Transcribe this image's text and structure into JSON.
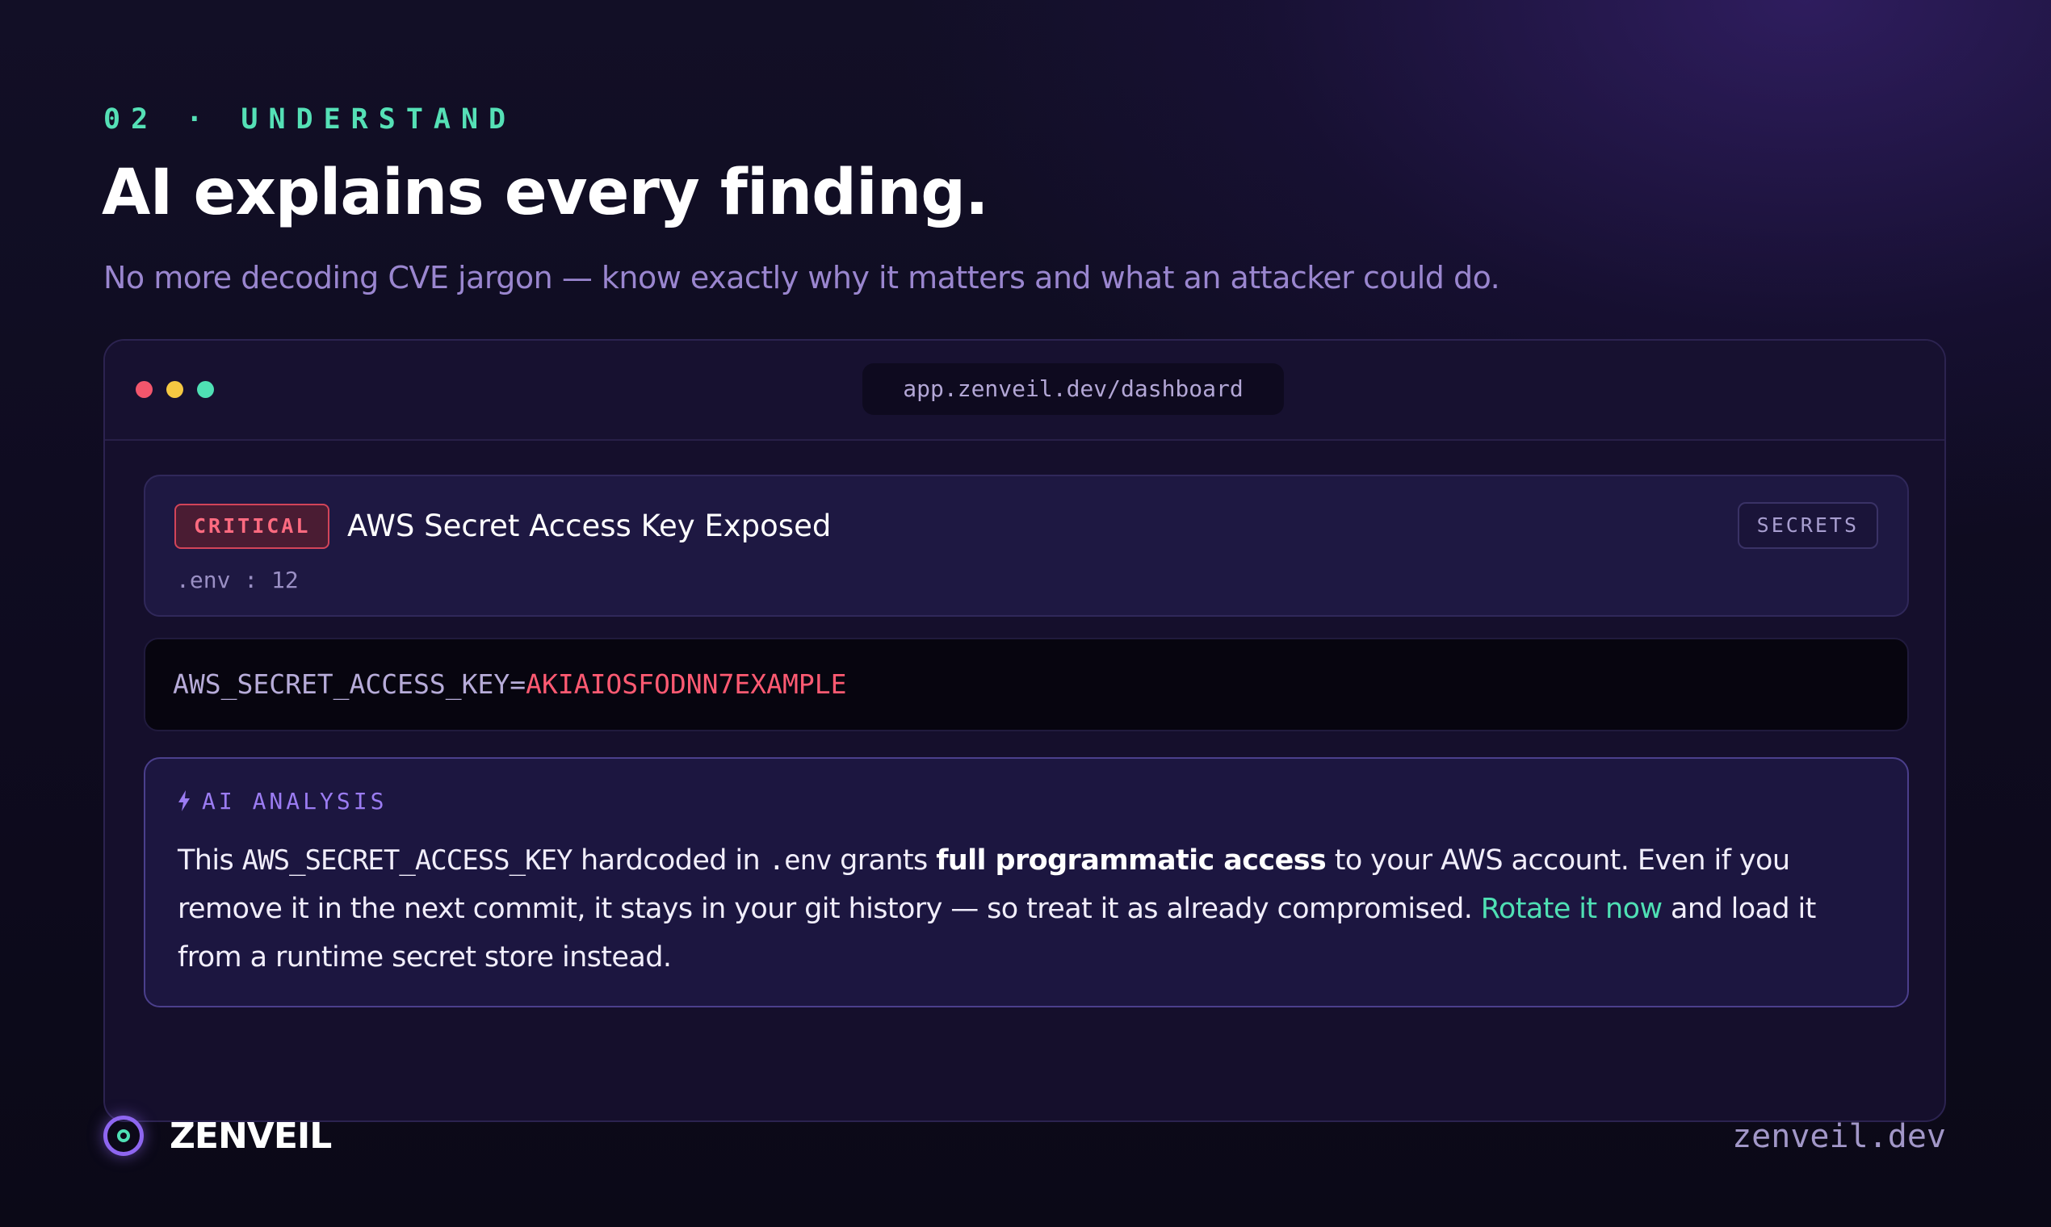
{
  "section": {
    "number": "02",
    "separator": "·",
    "name": "UNDERSTAND"
  },
  "headline": "AI explains every finding.",
  "subhead": "No more decoding CVE jargon — know exactly why it matters and what an attacker could do.",
  "window": {
    "url": "app.zenveil.dev/dashboard"
  },
  "finding": {
    "severity": "CRITICAL",
    "title": "AWS Secret Access Key Exposed",
    "location": ".env : 12",
    "category": "SECRETS",
    "code_key": "AWS_SECRET_ACCESS_KEY=",
    "code_value": "AKIAIOSFODNN7EXAMPLE"
  },
  "analysis": {
    "label": "AI ANALYSIS",
    "icon": "bolt-icon",
    "t1": "This ",
    "c1": "AWS_SECRET_ACCESS_KEY",
    "t2": " hardcoded in ",
    "c2": ".env",
    "t3": " grants ",
    "b1": "full programmatic access",
    "t4": " to your AWS account. Even if you remove it in the next commit, it stays in your git history — so treat it as already compromised. ",
    "link": "Rotate it now",
    "t5": " and load it from a runtime secret store instead."
  },
  "footer": {
    "brand": "ZENVEIL",
    "site": "zenveil.dev"
  },
  "colors": {
    "accent_green": "#4fe0b4",
    "accent_purple": "#9b7cf2",
    "critical_red": "#ff5a72",
    "background": "#0e0b1f"
  }
}
